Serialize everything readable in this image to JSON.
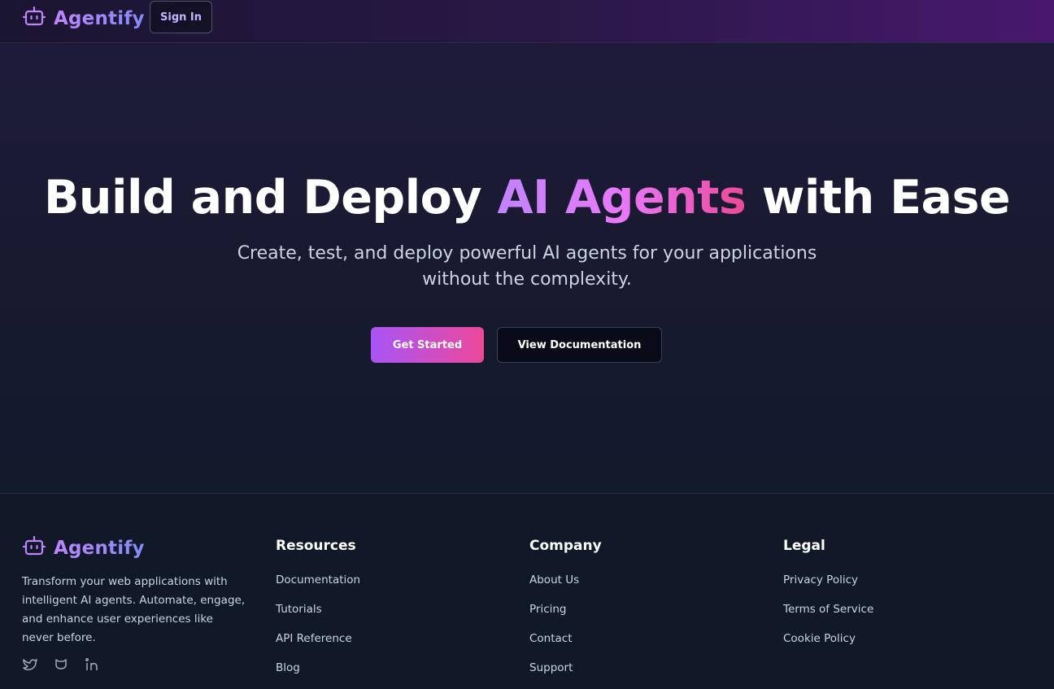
{
  "brand": {
    "name": "Agentify",
    "icon": "robot-icon",
    "accent_start": "#c084fc",
    "accent_end": "#818cf8"
  },
  "header": {
    "sign_in_label": "Sign In"
  },
  "hero": {
    "title_before": "Build and Deploy ",
    "title_highlight": "AI Agents",
    "title_after": " with Ease",
    "subtitle_line1": "Create, test, and deploy powerful AI agents for your applications",
    "subtitle_line2": "without the complexity.",
    "primary_button": "Get Started",
    "secondary_button": "View Documentation",
    "gradient_start": "#a855f7",
    "gradient_end": "#ec4899"
  },
  "footer": {
    "description": "Transform your web applications with intelligent AI agents. Automate, engage, and enhance user experiences like never before.",
    "socials": [
      "twitter-icon",
      "github-icon",
      "linkedin-icon"
    ],
    "columns": [
      {
        "title": "Resources",
        "links": [
          "Documentation",
          "Tutorials",
          "API Reference",
          "Blog"
        ]
      },
      {
        "title": "Company",
        "links": [
          "About Us",
          "Pricing",
          "Contact",
          "Support"
        ]
      },
      {
        "title": "Legal",
        "links": [
          "Privacy Policy",
          "Terms of Service",
          "Cookie Policy"
        ]
      }
    ]
  }
}
